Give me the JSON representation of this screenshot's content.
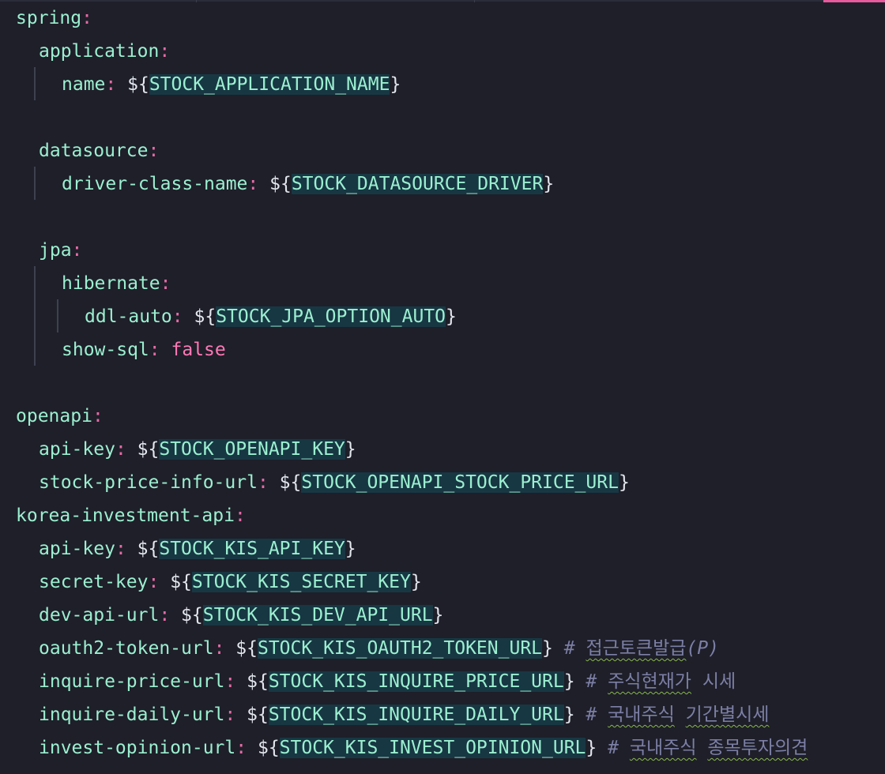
{
  "lines": [
    {
      "key": "spring",
      "value": null
    },
    {
      "key": "application",
      "value": null
    },
    {
      "key": "name",
      "var": "STOCK_APPLICATION_NAME"
    },
    {
      "key": "datasource",
      "value": null
    },
    {
      "key": "driver-class-name",
      "var": "STOCK_DATASOURCE_DRIVER"
    },
    {
      "key": "jpa",
      "value": null
    },
    {
      "key": "hibernate",
      "value": null
    },
    {
      "key": "ddl-auto",
      "var": "STOCK_JPA_OPTION_AUTO"
    },
    {
      "key": "show-sql",
      "literal": "false"
    },
    {
      "key": "openapi",
      "value": null
    },
    {
      "key": "api-key",
      "var": "STOCK_OPENAPI_KEY"
    },
    {
      "key": "stock-price-info-url",
      "var": "STOCK_OPENAPI_STOCK_PRICE_URL"
    },
    {
      "key": "korea-investment-api",
      "value": null
    },
    {
      "key": "api-key",
      "var": "STOCK_KIS_API_KEY"
    },
    {
      "key": "secret-key",
      "var": "STOCK_KIS_SECRET_KEY"
    },
    {
      "key": "dev-api-url",
      "var": "STOCK_KIS_DEV_API_URL"
    },
    {
      "key": "oauth2-token-url",
      "var": "STOCK_KIS_OAUTH2_TOKEN_URL",
      "comment": [
        "접근토큰발급",
        "(P)"
      ]
    },
    {
      "key": "inquire-price-url",
      "var": "STOCK_KIS_INQUIRE_PRICE_URL",
      "comment": [
        "주식현재가",
        "시세"
      ]
    },
    {
      "key": "inquire-daily-url",
      "var": "STOCK_KIS_INQUIRE_DAILY_URL",
      "comment": [
        "국내주식",
        "기간별시세"
      ]
    },
    {
      "key": "invest-opinion-url",
      "var": "STOCK_KIS_INVEST_OPINION_URL",
      "comment": [
        "국내주식",
        "종목투자의견"
      ]
    }
  ],
  "syntax": {
    "dollar_open": "${",
    "close_brace": "}",
    "colon": ":",
    "hash": "#"
  },
  "colors": {
    "background": "#1e1f29",
    "key": "#9cefd0",
    "colon": "#e86aa7",
    "variable_highlight": "#173743",
    "boolean": "#ff79b6",
    "comment": "#7c7fa5",
    "top_accent": "#e75a9c"
  }
}
